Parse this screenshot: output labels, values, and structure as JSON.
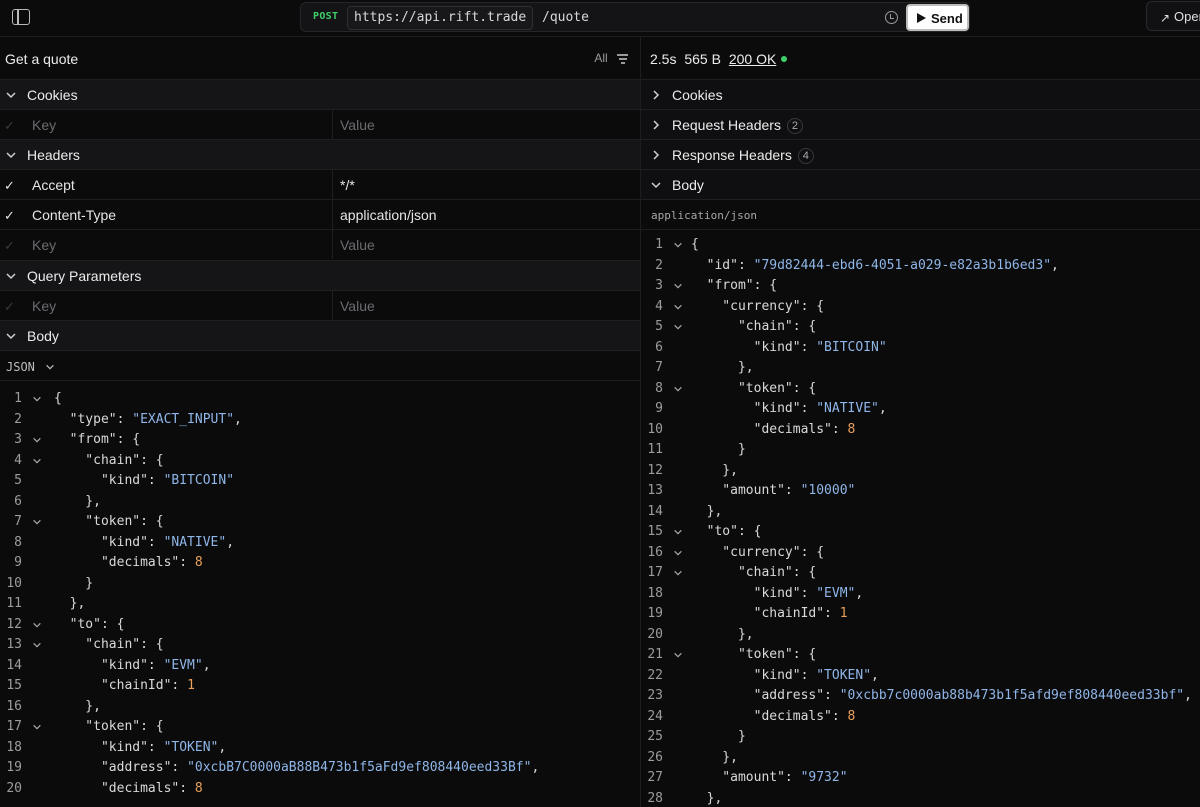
{
  "toolbar": {
    "method": "POST",
    "url_base": "https://api.rift.trade",
    "url_path": "/quote",
    "send_label": "Send",
    "open_label": "Open"
  },
  "request": {
    "title": "Get a quote",
    "filter_label": "All",
    "sections": {
      "cookies": "Cookies",
      "headers": "Headers",
      "query": "Query Parameters",
      "body": "Body"
    },
    "key_placeholder": "Key",
    "value_placeholder": "Value",
    "headers": [
      {
        "key": "Accept",
        "value": "*/*"
      },
      {
        "key": "Content-Type",
        "value": "application/json"
      }
    ],
    "body_format": "JSON",
    "body_lines": [
      [
        [
          "p",
          "{"
        ]
      ],
      [
        [
          "p",
          "  "
        ],
        [
          "p",
          "\"type\": "
        ],
        [
          "s",
          "\"EXACT_INPUT\""
        ],
        [
          "p",
          ","
        ]
      ],
      [
        [
          "p",
          "  \"from\": {"
        ]
      ],
      [
        [
          "p",
          "    \"chain\": {"
        ]
      ],
      [
        [
          "p",
          "      \"kind\": "
        ],
        [
          "s",
          "\"BITCOIN\""
        ]
      ],
      [
        [
          "p",
          "    },"
        ]
      ],
      [
        [
          "p",
          "    \"token\": {"
        ]
      ],
      [
        [
          "p",
          "      \"kind\": "
        ],
        [
          "s",
          "\"NATIVE\""
        ],
        [
          "p",
          ","
        ]
      ],
      [
        [
          "p",
          "      \"decimals\": "
        ],
        [
          "n",
          "8"
        ]
      ],
      [
        [
          "p",
          "    }"
        ]
      ],
      [
        [
          "p",
          "  },"
        ]
      ],
      [
        [
          "p",
          "  \"to\": {"
        ]
      ],
      [
        [
          "p",
          "    \"chain\": {"
        ]
      ],
      [
        [
          "p",
          "      \"kind\": "
        ],
        [
          "s",
          "\"EVM\""
        ],
        [
          "p",
          ","
        ]
      ],
      [
        [
          "p",
          "      \"chainId\": "
        ],
        [
          "n",
          "1"
        ]
      ],
      [
        [
          "p",
          "    },"
        ]
      ],
      [
        [
          "p",
          "    \"token\": {"
        ]
      ],
      [
        [
          "p",
          "      \"kind\": "
        ],
        [
          "s",
          "\"TOKEN\""
        ],
        [
          "p",
          ","
        ]
      ],
      [
        [
          "p",
          "      \"address\": "
        ],
        [
          "s",
          "\"0xcbB7C0000aB88B473b1f5aFd9ef808440eed33Bf\""
        ],
        [
          "p",
          ","
        ]
      ],
      [
        [
          "p",
          "      \"decimals\": "
        ],
        [
          "n",
          "8"
        ]
      ]
    ],
    "body_folds": [
      1,
      3,
      4,
      7,
      12,
      13,
      17
    ]
  },
  "response": {
    "time": "2.5s",
    "size": "565 B",
    "status": "200 OK",
    "status_color": "#3fcf6a",
    "sections": {
      "cookies": "Cookies",
      "request_headers": "Request Headers",
      "request_headers_count": "2",
      "response_headers": "Response Headers",
      "response_headers_count": "4",
      "body": "Body"
    },
    "content_type": "application/json",
    "body_lines": [
      [
        [
          "p",
          "{"
        ]
      ],
      [
        [
          "p",
          "  \"id\": "
        ],
        [
          "s",
          "\"79d82444-ebd6-4051-a029-e82a3b1b6ed3\""
        ],
        [
          "p",
          ","
        ]
      ],
      [
        [
          "p",
          "  \"from\": {"
        ]
      ],
      [
        [
          "p",
          "    \"currency\": {"
        ]
      ],
      [
        [
          "p",
          "      \"chain\": {"
        ]
      ],
      [
        [
          "p",
          "        \"kind\": "
        ],
        [
          "s",
          "\"BITCOIN\""
        ]
      ],
      [
        [
          "p",
          "      },"
        ]
      ],
      [
        [
          "p",
          "      \"token\": {"
        ]
      ],
      [
        [
          "p",
          "        \"kind\": "
        ],
        [
          "s",
          "\"NATIVE\""
        ],
        [
          "p",
          ","
        ]
      ],
      [
        [
          "p",
          "        \"decimals\": "
        ],
        [
          "n",
          "8"
        ]
      ],
      [
        [
          "p",
          "      }"
        ]
      ],
      [
        [
          "p",
          "    },"
        ]
      ],
      [
        [
          "p",
          "    \"amount\": "
        ],
        [
          "s",
          "\"10000\""
        ]
      ],
      [
        [
          "p",
          "  },"
        ]
      ],
      [
        [
          "p",
          "  \"to\": {"
        ]
      ],
      [
        [
          "p",
          "    \"currency\": {"
        ]
      ],
      [
        [
          "p",
          "      \"chain\": {"
        ]
      ],
      [
        [
          "p",
          "        \"kind\": "
        ],
        [
          "s",
          "\"EVM\""
        ],
        [
          "p",
          ","
        ]
      ],
      [
        [
          "p",
          "        \"chainId\": "
        ],
        [
          "n",
          "1"
        ]
      ],
      [
        [
          "p",
          "      },"
        ]
      ],
      [
        [
          "p",
          "      \"token\": {"
        ]
      ],
      [
        [
          "p",
          "        \"kind\": "
        ],
        [
          "s",
          "\"TOKEN\""
        ],
        [
          "p",
          ","
        ]
      ],
      [
        [
          "p",
          "        \"address\": "
        ],
        [
          "s",
          "\"0xcbb7c0000ab88b473b1f5afd9ef808440eed33bf\""
        ],
        [
          "p",
          ","
        ]
      ],
      [
        [
          "p",
          "        \"decimals\": "
        ],
        [
          "n",
          "8"
        ]
      ],
      [
        [
          "p",
          "      }"
        ]
      ],
      [
        [
          "p",
          "    },"
        ]
      ],
      [
        [
          "p",
          "    \"amount\": "
        ],
        [
          "s",
          "\"9732\""
        ]
      ],
      [
        [
          "p",
          "  },"
        ]
      ]
    ],
    "body_folds": [
      1,
      3,
      4,
      5,
      8,
      15,
      16,
      17,
      21
    ]
  },
  "icons": {
    "sidebar": "sidebar-toggle-icon",
    "history": "history-icon",
    "play": "play-icon",
    "open": "arrow-up-right-icon",
    "filter": "filter-icon",
    "chevron_down": "chevron-down-icon",
    "chevron_right": "chevron-right-icon",
    "check": "check-icon"
  }
}
